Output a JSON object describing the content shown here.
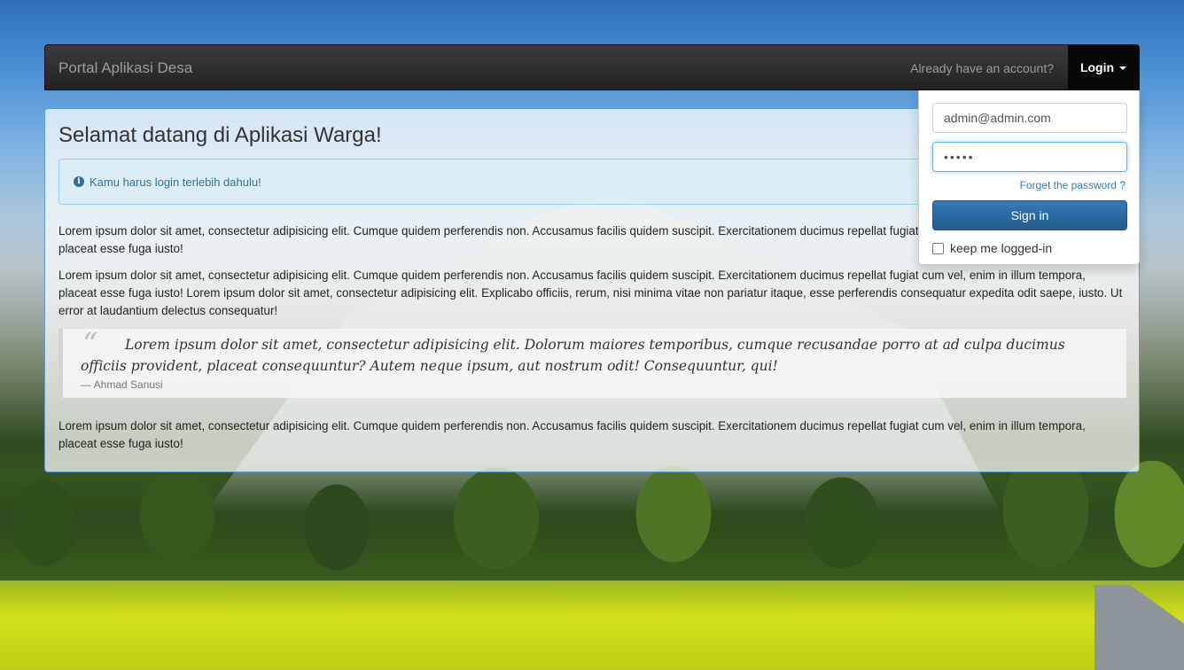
{
  "navbar": {
    "brand": "Portal Aplikasi Desa",
    "account_text": "Already have an account?",
    "login_label": "Login"
  },
  "main": {
    "title": "Selamat datang di Aplikasi Warga!",
    "alert": "Kamu harus login terlebih dahulu!",
    "paragraphs": [
      "Lorem ipsum dolor sit amet, consectetur adipisicing elit. Cumque quidem perferendis non. Accusamus facilis quidem suscipit. Exercitationem ducimus repellat fugiat cum vel, enim in illum tempora, placeat esse fuga iusto!",
      "Lorem ipsum dolor sit amet, consectetur adipisicing elit. Cumque quidem perferendis non. Accusamus facilis quidem suscipit. Exercitationem ducimus repellat fugiat cum vel, enim in illum tempora, placeat esse fuga iusto! Lorem ipsum dolor sit amet, consectetur adipisicing elit. Explicabo officiis, rerum, nisi minima vitae non pariatur itaque, esse perferendis consequatur expedita odit saepe, iusto. Ut error at laudantium delectus consequatur!",
      "Lorem ipsum dolor sit amet, consectetur adipisicing elit. Cumque quidem perferendis non. Accusamus facilis quidem suscipit. Exercitationem ducimus repellat fugiat cum vel, enim in illum tempora, placeat esse fuga iusto!"
    ],
    "quote": {
      "mark": "“",
      "text": "Lorem ipsum dolor sit amet, consectetur adipisicing elit. Dolorum maiores temporibus, cumque recusandae porro at ad culpa ducimus officiis provident, placeat consequuntur? Autem neque ipsum, aut nostrum odit! Consequuntur, qui!",
      "author": "— Ahmad Sanusi"
    }
  },
  "login_form": {
    "email_value": "admin@admin.com",
    "password_value": "•••••",
    "forget_label": "Forget the password ?",
    "signin_label": "Sign in",
    "keep_label": "keep me logged-in"
  },
  "colors": {
    "accent": "#337ab7",
    "alert_text": "#31708f",
    "navbar_bg": "#222222"
  }
}
